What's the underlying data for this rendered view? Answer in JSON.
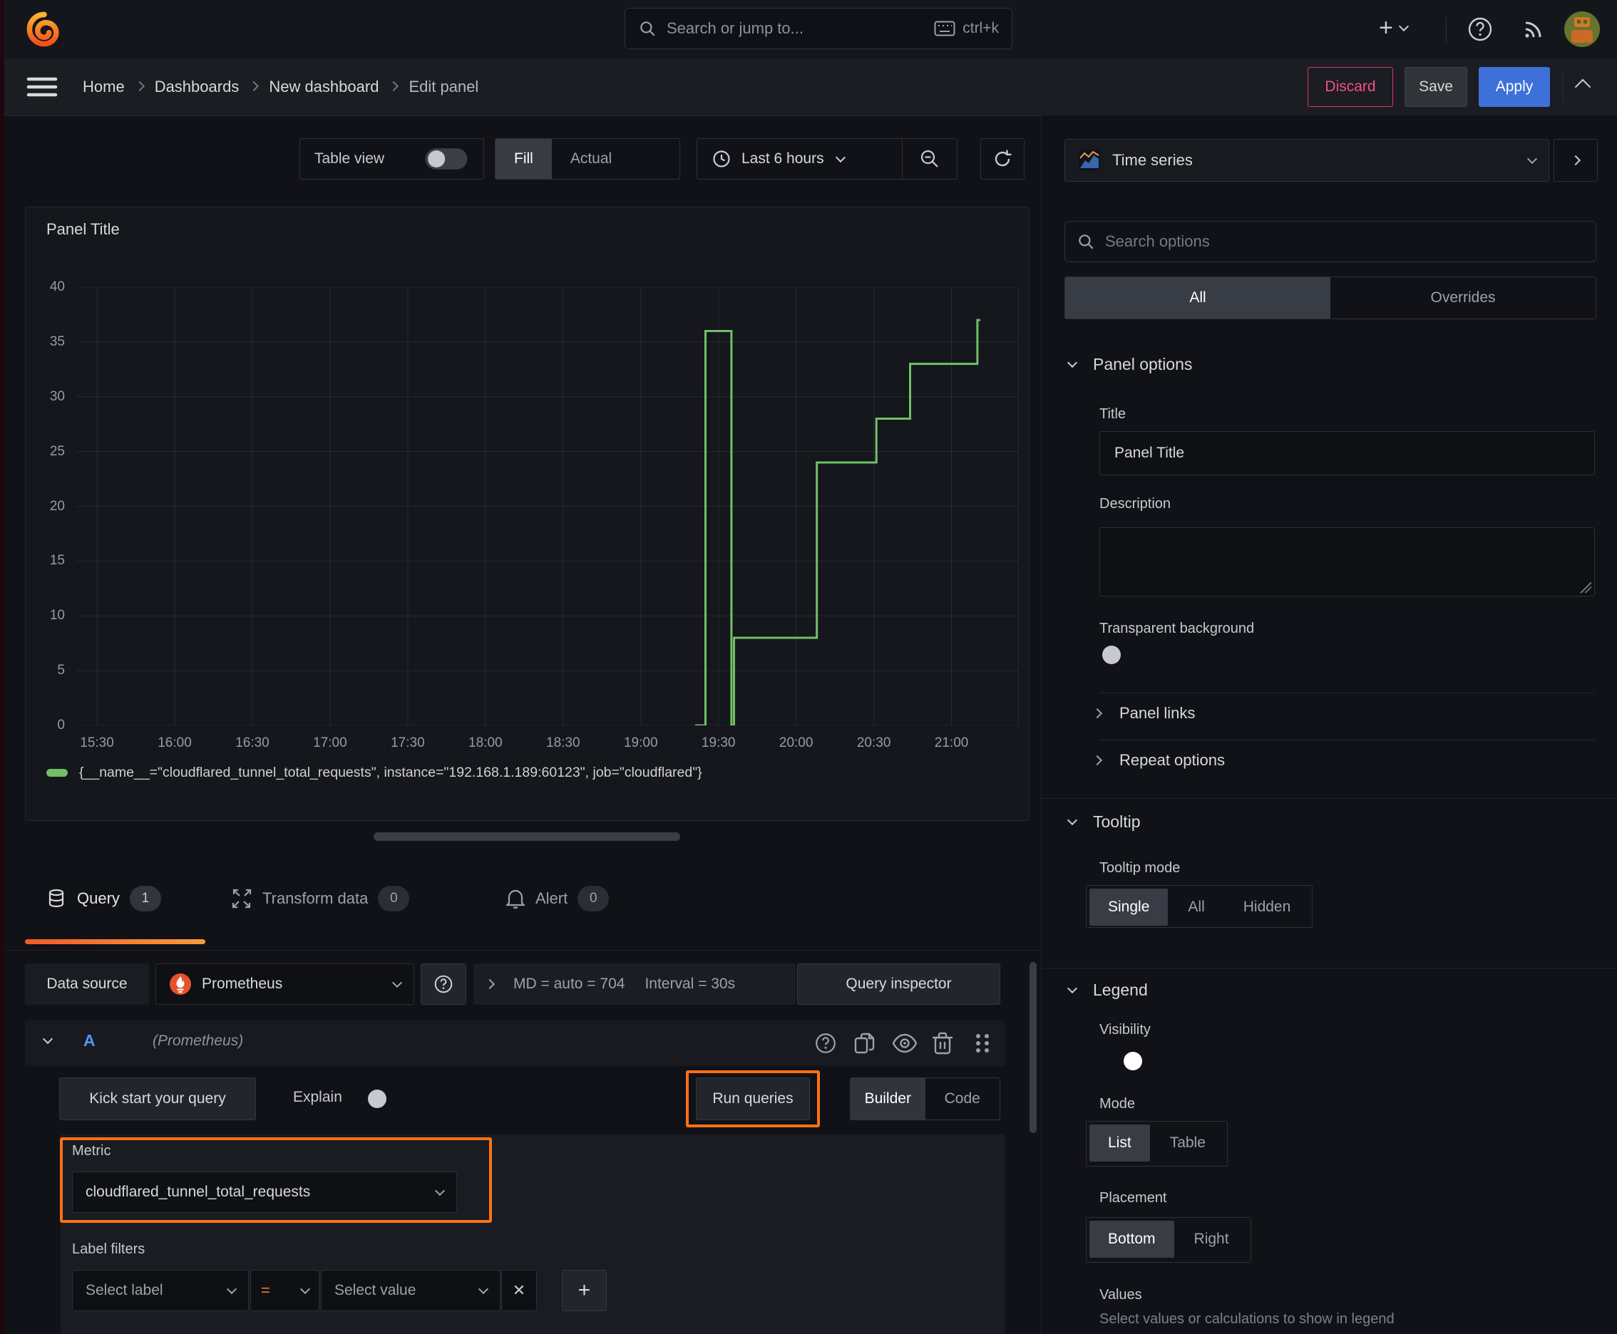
{
  "topbar": {
    "search_placeholder": "Search or jump to...",
    "shortcut": "ctrl+k"
  },
  "breadcrumb": {
    "items": [
      "Home",
      "Dashboards",
      "New dashboard",
      "Edit panel"
    ],
    "discard": "Discard",
    "save": "Save",
    "apply": "Apply"
  },
  "toolbar": {
    "table_view": "Table view",
    "fill": "Fill",
    "actual": "Actual",
    "time_range": "Last 6 hours"
  },
  "panel": {
    "title": "Panel Title"
  },
  "chart_data": {
    "type": "line",
    "title": "Panel Title",
    "xlabel": "",
    "ylabel": "",
    "x_ticks": [
      "15:30",
      "16:00",
      "16:30",
      "17:00",
      "17:30",
      "18:00",
      "18:30",
      "19:00",
      "19:30",
      "20:00",
      "20:30",
      "21:00"
    ],
    "y_ticks": [
      0,
      5,
      10,
      15,
      20,
      25,
      30,
      35,
      40
    ],
    "ylim": [
      0,
      40
    ],
    "xlim": [
      "15:22",
      "21:26"
    ],
    "grid": true,
    "legend_position": "bottom",
    "series": [
      {
        "name": "{__name__=\"cloudflared_tunnel_total_requests\", instance=\"192.168.1.189:60123\", job=\"cloudflared\"}",
        "color": "#73BF69",
        "step": true,
        "points": [
          [
            "19:21",
            0
          ],
          [
            "19:25",
            36
          ],
          [
            "19:35",
            0
          ],
          [
            "19:36",
            8
          ],
          [
            "20:08",
            24
          ],
          [
            "20:31",
            28
          ],
          [
            "20:44",
            33
          ],
          [
            "21:10",
            37
          ]
        ]
      }
    ]
  },
  "tabs": {
    "query": "Query",
    "query_count": "1",
    "transform": "Transform data",
    "transform_count": "0",
    "alert": "Alert",
    "alert_count": "0"
  },
  "datasource": {
    "label": "Data source",
    "name": "Prometheus",
    "max_data_points": "MD = auto = 704",
    "interval": "Interval = 30s",
    "query_inspector": "Query inspector"
  },
  "query": {
    "ref_id": "A",
    "ds_hint": "(Prometheus)",
    "kick_start": "Kick start your query",
    "explain": "Explain",
    "run_queries": "Run queries",
    "builder": "Builder",
    "code": "Code",
    "metric_label": "Metric",
    "metric_value": "cloudflared_tunnel_total_requests",
    "label_filters": "Label filters",
    "select_label": "Select label",
    "operator": "=",
    "select_value": "Select value"
  },
  "options": {
    "viz_name": "Time series",
    "search_placeholder": "Search options",
    "tab_all": "All",
    "tab_overrides": "Overrides",
    "panel_options": {
      "heading": "Panel options",
      "title_label": "Title",
      "title_value": "Panel Title",
      "description_label": "Description",
      "transparent_label": "Transparent background"
    },
    "panel_links": "Panel links",
    "repeat_options": "Repeat options",
    "tooltip": {
      "heading": "Tooltip",
      "mode_label": "Tooltip mode",
      "single": "Single",
      "all": "All",
      "hidden": "Hidden"
    },
    "legend": {
      "heading": "Legend",
      "visibility": "Visibility",
      "mode_label": "Mode",
      "list": "List",
      "table": "Table",
      "placement_label": "Placement",
      "bottom": "Bottom",
      "right": "Right",
      "values_label": "Values",
      "values_hint": "Select values or calculations to show in legend"
    }
  },
  "icons": {
    "question": "?",
    "close": "✕",
    "plus": "+"
  },
  "colors": {
    "accent_orange": "#FF7114",
    "series_green": "#73BF69",
    "primary_blue": "#3D71D9",
    "danger_pink": "#E0326F",
    "toggle_on_blue": "#3871DC"
  }
}
